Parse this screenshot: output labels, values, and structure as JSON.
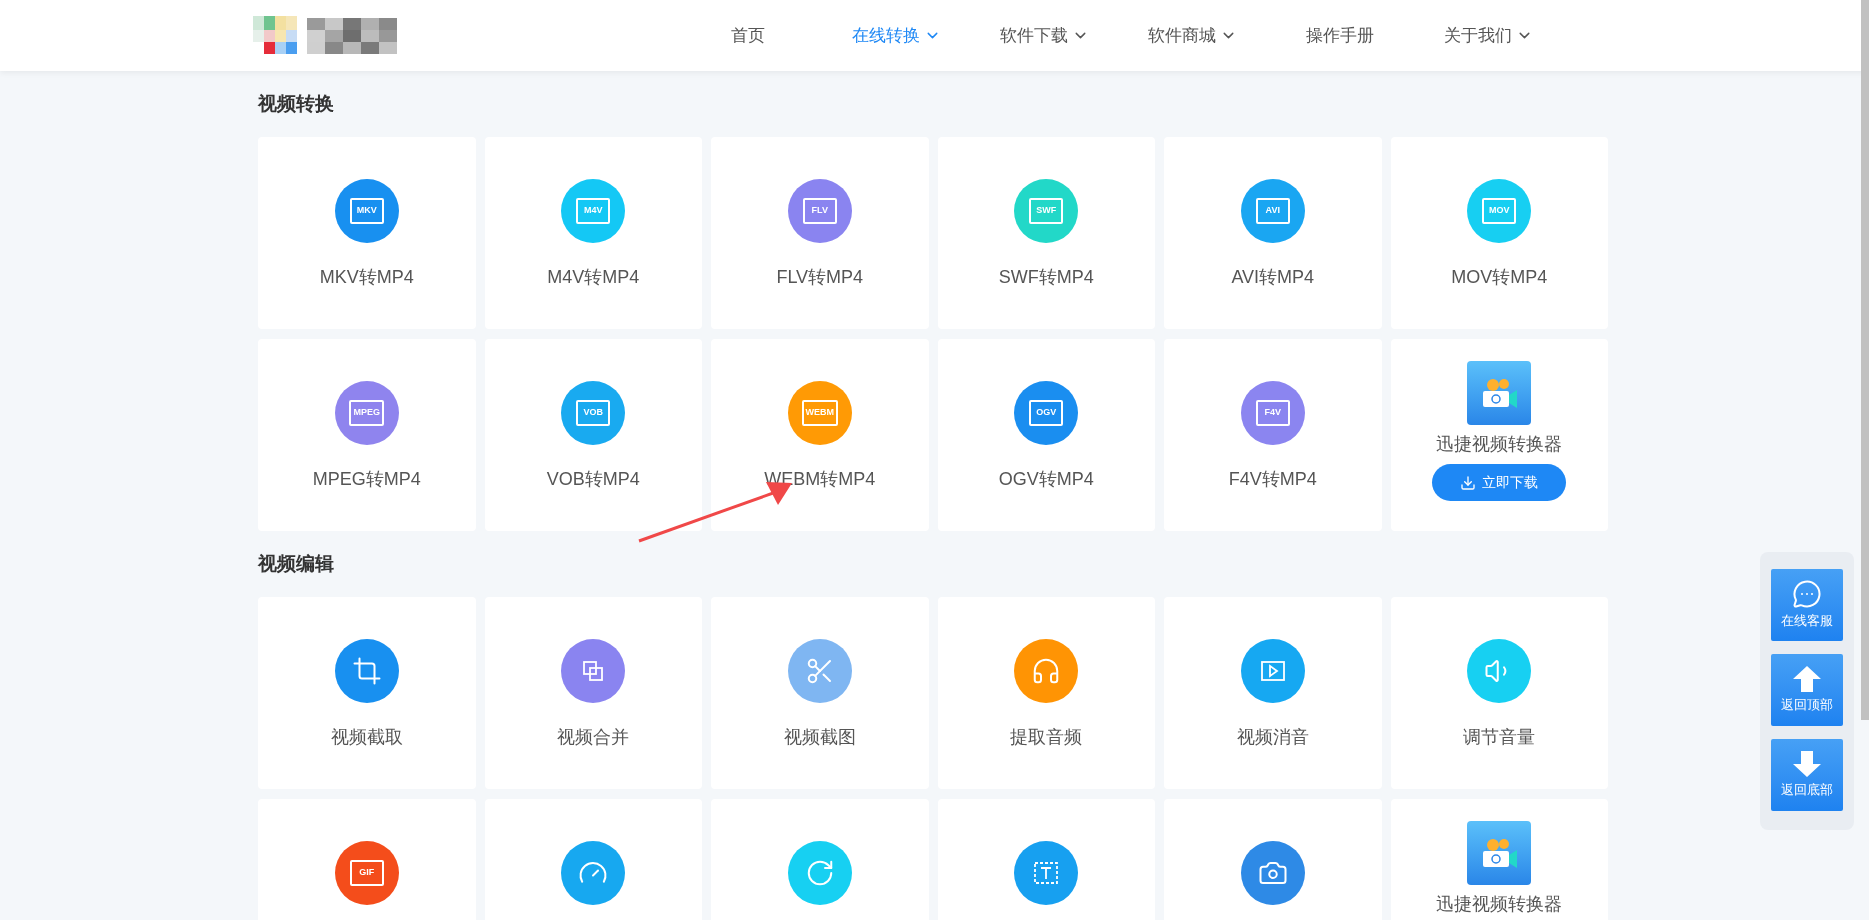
{
  "nav": {
    "items": [
      {
        "label": "首页",
        "selected": false,
        "dropdown": false
      },
      {
        "label": "在线转换",
        "selected": true,
        "dropdown": true
      },
      {
        "label": "软件下载",
        "selected": false,
        "dropdown": true
      },
      {
        "label": "软件商城",
        "selected": false,
        "dropdown": true
      },
      {
        "label": "操作手册",
        "selected": false,
        "dropdown": false
      },
      {
        "label": "关于我们",
        "selected": false,
        "dropdown": true
      }
    ]
  },
  "sections": [
    {
      "title": "视频转换",
      "cards": [
        {
          "kind": "format",
          "badge": "MKV",
          "label": "MKV转MP4",
          "color": "#1890f0"
        },
        {
          "kind": "format",
          "badge": "M4V",
          "label": "M4V转MP4",
          "color": "#14c8f5"
        },
        {
          "kind": "format",
          "badge": "FLV",
          "label": "FLV转MP4",
          "color": "#8a84f0"
        },
        {
          "kind": "format",
          "badge": "SWF",
          "label": "SWF转MP4",
          "color": "#22d8c8"
        },
        {
          "kind": "format",
          "badge": "AVI",
          "label": "AVI转MP4",
          "color": "#1aa6f2"
        },
        {
          "kind": "format",
          "badge": "MOV",
          "label": "MOV转MP4",
          "color": "#17cff2"
        },
        {
          "kind": "format",
          "badge": "MPEG",
          "label": "MPEG转MP4",
          "color": "#8f84ee"
        },
        {
          "kind": "format",
          "badge": "VOB",
          "label": "VOB转MP4",
          "color": "#19aaf0"
        },
        {
          "kind": "format",
          "badge": "WEBM",
          "label": "WEBM转MP4",
          "color": "#ff9a05"
        },
        {
          "kind": "format",
          "badge": "OGV",
          "label": "OGV转MP4",
          "color": "#1a8ef0"
        },
        {
          "kind": "format",
          "badge": "F4V",
          "label": "F4V转MP4",
          "color": "#8b85f0"
        },
        {
          "kind": "app",
          "title": "迅捷视频转换器",
          "button": "立即下载"
        }
      ]
    },
    {
      "title": "视频编辑",
      "cards": [
        {
          "kind": "crop",
          "label": "视频截取",
          "color": "#1890f0"
        },
        {
          "kind": "merge",
          "label": "视频合并",
          "color": "#8a84f0"
        },
        {
          "kind": "scissors",
          "label": "视频截图",
          "color": "#7fb6f2"
        },
        {
          "kind": "headphones",
          "label": "提取音频",
          "color": "#ff9404"
        },
        {
          "kind": "play",
          "label": "视频消音",
          "color": "#16a8f2"
        },
        {
          "kind": "volume",
          "label": "调节音量",
          "color": "#17d0f2"
        },
        {
          "kind": "format",
          "badge": "GIF",
          "color": "#f44d1b"
        },
        {
          "kind": "gauge",
          "color": "#17a8f0"
        },
        {
          "kind": "rotate",
          "color": "#17d0f2"
        },
        {
          "kind": "text",
          "color": "#17a0f0"
        },
        {
          "kind": "camera",
          "color": "#2e8ae6"
        },
        {
          "kind": "app",
          "title": "迅捷视频转换器"
        }
      ]
    }
  ],
  "side_buttons": [
    {
      "kind": "chat",
      "label": "在线客服"
    },
    {
      "kind": "up",
      "label": "返回顶部"
    },
    {
      "kind": "down",
      "label": "返回底部"
    }
  ]
}
